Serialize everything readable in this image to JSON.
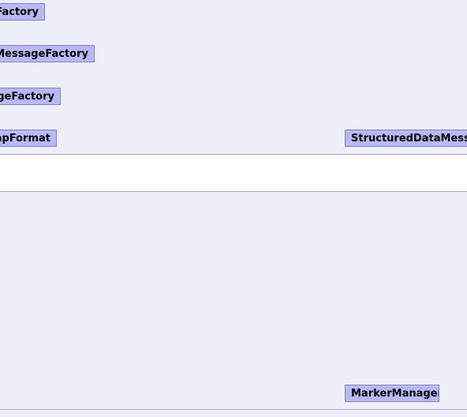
{
  "nodes": [
    {
      "label": "eFactory"
    },
    {
      "label": "rMessageFactory"
    },
    {
      "label": "ageFactory"
    },
    {
      "label": "apFormat"
    },
    {
      "label": "StructuredDataMessag"
    },
    {
      "label": "MarkerManager"
    }
  ]
}
